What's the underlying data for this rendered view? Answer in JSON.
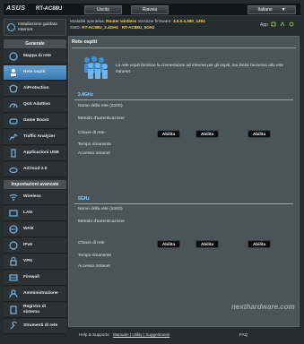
{
  "header": {
    "logo": "ASUS",
    "model": "RT-AC88U",
    "buttons": [
      "Uscita",
      "Riavvia",
      "Italiano"
    ]
  },
  "status": {
    "mode_label": "Modalità operativa:",
    "mode_value": "Router wireless",
    "firmware_label": "Versione firmware:",
    "firmware_value": "3.0.0.4.380_1354",
    "ssid_label": "SSID:",
    "ssid_values": "RT-AC88U_2.4GHz   RT-AC88U_5GHz",
    "app_label": "App"
  },
  "sidebar": {
    "setup_label": "Installazione guidata Internet",
    "general_header": "Generale",
    "general_items": [
      {
        "label": "Mappa di rete",
        "icon": "network-map-icon"
      },
      {
        "label": "Rete ospiti",
        "icon": "guest-network-icon"
      },
      {
        "label": "AiProtection",
        "icon": "aiprotection-icon"
      },
      {
        "label": "QoS Adattivo",
        "icon": "qos-icon"
      },
      {
        "label": "Game Boost",
        "icon": "game-boost-icon"
      },
      {
        "label": "Traffic Analyzer",
        "icon": "traffic-analyzer-icon"
      },
      {
        "label": "Applicazioni USB",
        "icon": "usb-icon"
      },
      {
        "label": "AiCloud 2.0",
        "icon": "aicloud-icon"
      }
    ],
    "advanced_header": "Impostazioni avanzate",
    "advanced_items": [
      {
        "label": "Wireless",
        "icon": "wireless-icon"
      },
      {
        "label": "LAN",
        "icon": "lan-icon"
      },
      {
        "label": "WAN",
        "icon": "wan-icon"
      },
      {
        "label": "IPv6",
        "icon": "ipv6-icon"
      },
      {
        "label": "VPN",
        "icon": "vpn-icon"
      },
      {
        "label": "Firewall",
        "icon": "firewall-icon"
      },
      {
        "label": "Amministrazione",
        "icon": "admin-icon"
      },
      {
        "label": "Registro di sistema",
        "icon": "system-log-icon"
      },
      {
        "label": "Strumenti di rete",
        "icon": "network-tools-icon"
      }
    ],
    "active_item": "Rete ospiti"
  },
  "main": {
    "title": "Rete ospiti",
    "description": "La rete ospiti fornisce la connessione ad Internet per gli ospiti, ma limita l'accesso alla rete Intranet.",
    "bands": [
      {
        "name": "2.4GHz",
        "rows": [
          "Nome della rete (SSID)",
          "Metodo d'autenticazione",
          "Chiave di rete",
          "Tempo rimanente",
          "Accesso Intranet"
        ],
        "buttons": [
          "Abilita",
          "Abilita",
          "Abilita"
        ]
      },
      {
        "name": "5GHz",
        "rows": [
          "Nome della rete (SSID)",
          "Metodo d'autenticazione",
          "Chiave di rete",
          "Tempo rimanente",
          "Accesso Intranet"
        ],
        "buttons": [
          "Abilita",
          "Abilita",
          "Abilita"
        ]
      }
    ]
  },
  "footer": {
    "help": "Help & Supporto",
    "links": "Manuale | Utility | Suggerimenti",
    "faq": "FAQ"
  },
  "watermark": "nexthardware.com",
  "colors": {
    "accent": "#3b79b1",
    "band_title": "#8fd0ff",
    "highlight": "#ffd34a"
  }
}
